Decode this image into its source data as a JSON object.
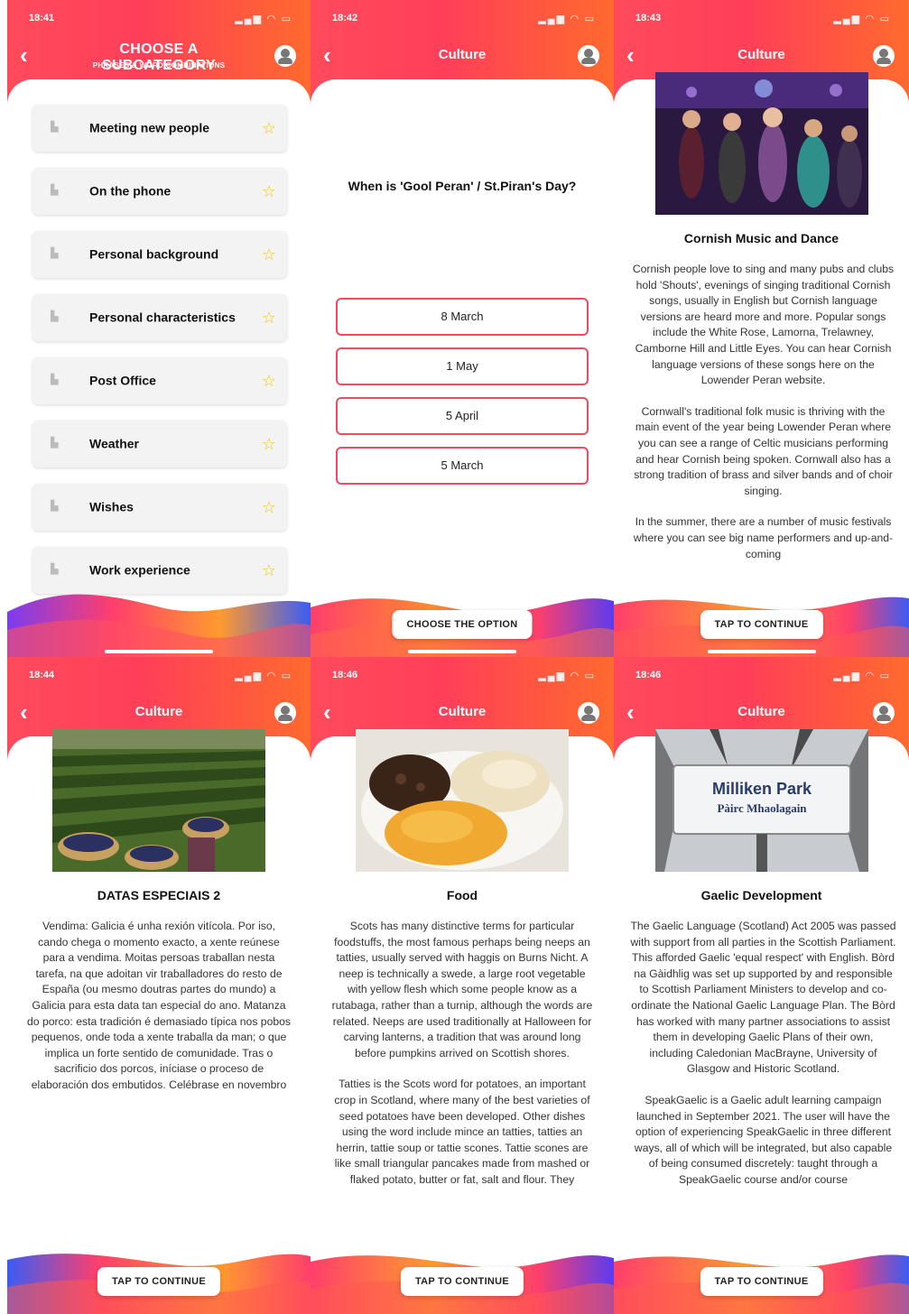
{
  "panels": [
    {
      "time": "18:41",
      "title": "CHOOSE A SUBCATEGORY",
      "subtitle": "PHRASES & WORD COMBINATIONS",
      "items": [
        {
          "label": "Meeting new people"
        },
        {
          "label": "On the phone"
        },
        {
          "label": "Personal background"
        },
        {
          "label": "Personal characteristics"
        },
        {
          "label": "Post Office"
        },
        {
          "label": "Weather"
        },
        {
          "label": "Wishes"
        },
        {
          "label": "Work experience"
        }
      ]
    },
    {
      "time": "18:42",
      "title": "Culture",
      "question": "When is 'Gool Peran' / St.Piran's Day?",
      "options": [
        "8 March",
        "1 May",
        "5 April",
        "5 March"
      ],
      "cta": "CHOOSE THE OPTION"
    },
    {
      "time": "18:43",
      "title": "Culture",
      "heading": "Cornish Music and Dance",
      "paragraphs": [
        "Cornish people love to sing and many pubs and clubs hold 'Shouts', evenings of singing traditional Cornish songs, usually in English but Cornish language versions are heard more and more. Popular songs include the White Rose, Lamorna, Trelawney, Camborne Hill and Little Eyes. You can hear Cornish language versions of these songs here on the Lowender Peran website.",
        "Cornwall's traditional folk music is thriving with the main event of the year being Lowender Peran where you can see a range of Celtic musicians performing and hear Cornish being spoken. Cornwall also has a strong tradition of brass and silver bands and of choir singing.",
        "In the summer, there are a number of music festivals where you can see big name performers and up-and-coming"
      ],
      "cta": "TAP TO CONTINUE"
    },
    {
      "time": "18:44",
      "title": "Culture",
      "heading": "DATAS ESPECIAIS 2",
      "paragraphs": [
        "Vendima: Galicia é unha rexión vitícola. Por iso, cando chega o momento exacto, a xente reúnese para a vendima. Moitas persoas traballan nesta tarefa, na que adoitan vir traballadores do resto de España (ou mesmo doutras partes do mundo) a Galicia para esta data tan especial do ano. Matanza do porco: esta tradición é demasiado típica nos pobos pequenos, onde toda a xente traballa da man; o que implica un forte sentido de comunidade. Tras o sacrificio dos porcos, iníciase o proceso de elaboración dos embutidos. Celébrase en novembro"
      ],
      "cta": "TAP TO CONTINUE"
    },
    {
      "time": "18:46",
      "title": "Culture",
      "heading": "Food",
      "paragraphs": [
        "Scots has many distinctive terms for particular foodstuffs, the most famous perhaps being neeps an tatties, usually served with haggis on Burns Nicht. A neep is technically a swede, a large root vegetable with yellow flesh which some people know as a rutabaga, rather than a turnip, although the words are related. Neeps are used traditionally at Halloween for carving lanterns, a tradition that was around long before pumpkins arrived on Scottish shores.",
        "Tatties is the Scots word for potatoes, an important crop in Scotland, where many of the best varieties of seed potatoes have been developed. Other dishes using the word include mince an tatties, tatties an herrin, tattie soup or tattie scones. Tattie scones are like small triangular pancakes made from mashed or flaked potato, butter or fat, salt and flour. They"
      ],
      "cta": "TAP TO CONTINUE"
    },
    {
      "time": "18:46",
      "title": "Culture",
      "heading": "Gaelic Development",
      "sign_line1": "Milliken Park",
      "sign_line2": "Pàirc Mhaolagain",
      "paragraphs": [
        "The Gaelic Language (Scotland) Act 2005 was passed with support from all parties in the Scottish Parliament. This afforded Gaelic 'equal respect' with English. Bòrd na Gàidhlig was set up supported by and responsible to Scottish Parliament Ministers to develop and co-ordinate the National Gaelic Language Plan. The Bòrd has worked with many partner associations to assist them in developing Gaelic Plans of their own, including Caledonian MacBrayne, University of Glasgow and Historic Scotland.",
        "SpeakGaelic is a Gaelic adult learning campaign launched in September 2021. The user will have the option of experiencing SpeakGaelic in three different ways, all of which will be integrated, but also capable of being consumed discretely: taught through a SpeakGaelic course and/or course"
      ],
      "cta": "TAP TO CONTINUE"
    }
  ],
  "icons": {
    "back": "chevron-left-icon",
    "profile": "profile-icon",
    "star": "star-icon"
  },
  "colors": {
    "header_start": "#ff4a5c",
    "header_end": "#ff6a2e",
    "accent_border": "#f04b5e",
    "star": "#f5c518"
  }
}
